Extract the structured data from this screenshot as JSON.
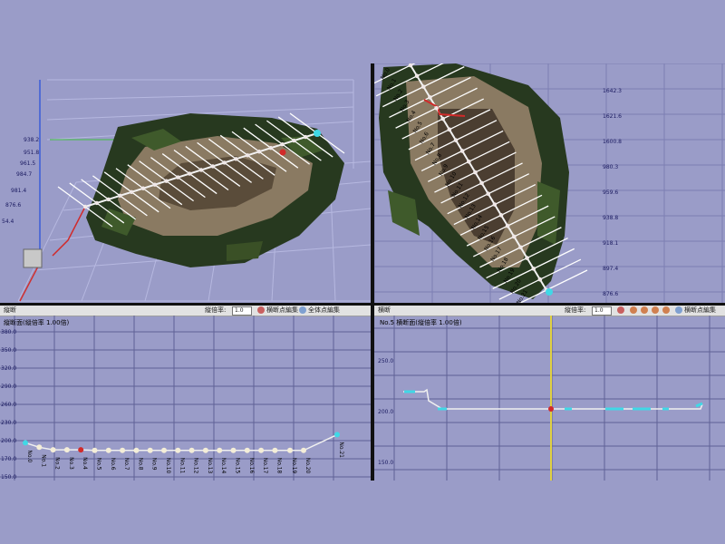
{
  "view3d": {
    "axis_z_labels": [
      "938.2",
      "951.8",
      "961.5",
      "984.7",
      "981.4",
      "876.6",
      "54.4"
    ]
  },
  "topview": {
    "y_ticks": [
      "1642.3",
      "1621.6",
      "1600.8",
      "980.3",
      "959.6",
      "938.8",
      "918.1",
      "897.4",
      "876.6"
    ],
    "station_labels": [
      "No.0",
      "No.1",
      "No.2",
      "No.3",
      "No.4",
      "No.5",
      "No.6",
      "No.7",
      "No.8",
      "No.9",
      "No.10",
      "No.11",
      "No.12",
      "No.13",
      "No.14",
      "No.15",
      "No.16",
      "No.17",
      "No.18",
      "No.19",
      "No.20",
      "No.21"
    ]
  },
  "profile": {
    "toolbar_tab": "縦断",
    "scale_label": "縦倍率:",
    "scale_value": "1.0",
    "btn_text": "横断点編集",
    "btn2_text": "全体点編集",
    "subtitle": "縦断面(縦倍率 1.00倍)",
    "y_ticks": [
      "380.0",
      "350.0",
      "320.0",
      "290.0",
      "260.0",
      "230.0",
      "200.0",
      "170.0",
      "150.0"
    ],
    "station_labels": [
      "No.0",
      "No.1",
      "No.2",
      "No.3",
      "No.4",
      "No.5",
      "No.6",
      "No.7",
      "No.8",
      "No.9",
      "No.10",
      "No.11",
      "No.12",
      "No.13",
      "No.14",
      "No.15",
      "No.16",
      "No.17",
      "No.18",
      "No.19",
      "No.20",
      "No.21"
    ]
  },
  "cross": {
    "toolbar_tab": "横断",
    "scale_label": "縦倍率:",
    "scale_value": "1.0",
    "btn_text": "横断点編集",
    "subtitle": "No.5 横断面(縦倍率 1.00倍)",
    "y_ticks": [
      "250.0",
      "200.0",
      "150.0"
    ]
  },
  "colors": {
    "bg": "#9a9cc8",
    "grid": "#6a6c9e",
    "line": "#f0f0f0",
    "accent": "#d12a2a",
    "cyan": "#40d8e6",
    "yellow": "#e0d040"
  },
  "chart_data": [
    {
      "type": "line",
      "title": "縦断面(縦倍率 1.00倍)",
      "categories": [
        "No.0",
        "No.1",
        "No.2",
        "No.3",
        "No.4",
        "No.5",
        "No.6",
        "No.7",
        "No.8",
        "No.9",
        "No.10",
        "No.11",
        "No.12",
        "No.13",
        "No.14",
        "No.15",
        "No.16",
        "No.17",
        "No.18",
        "No.19",
        "No.20",
        "No.21"
      ],
      "series": [
        {
          "values": [
            204,
            197,
            193,
            193,
            193,
            192,
            192,
            192,
            192,
            192,
            192,
            192,
            192,
            192,
            192,
            192,
            192,
            192,
            192,
            192,
            192,
            217
          ]
        }
      ],
      "ylim": [
        150,
        380
      ]
    },
    {
      "type": "line",
      "title": "No.5 横断面(縦倍率 1.00倍)",
      "ylim": [
        150,
        250
      ]
    }
  ]
}
